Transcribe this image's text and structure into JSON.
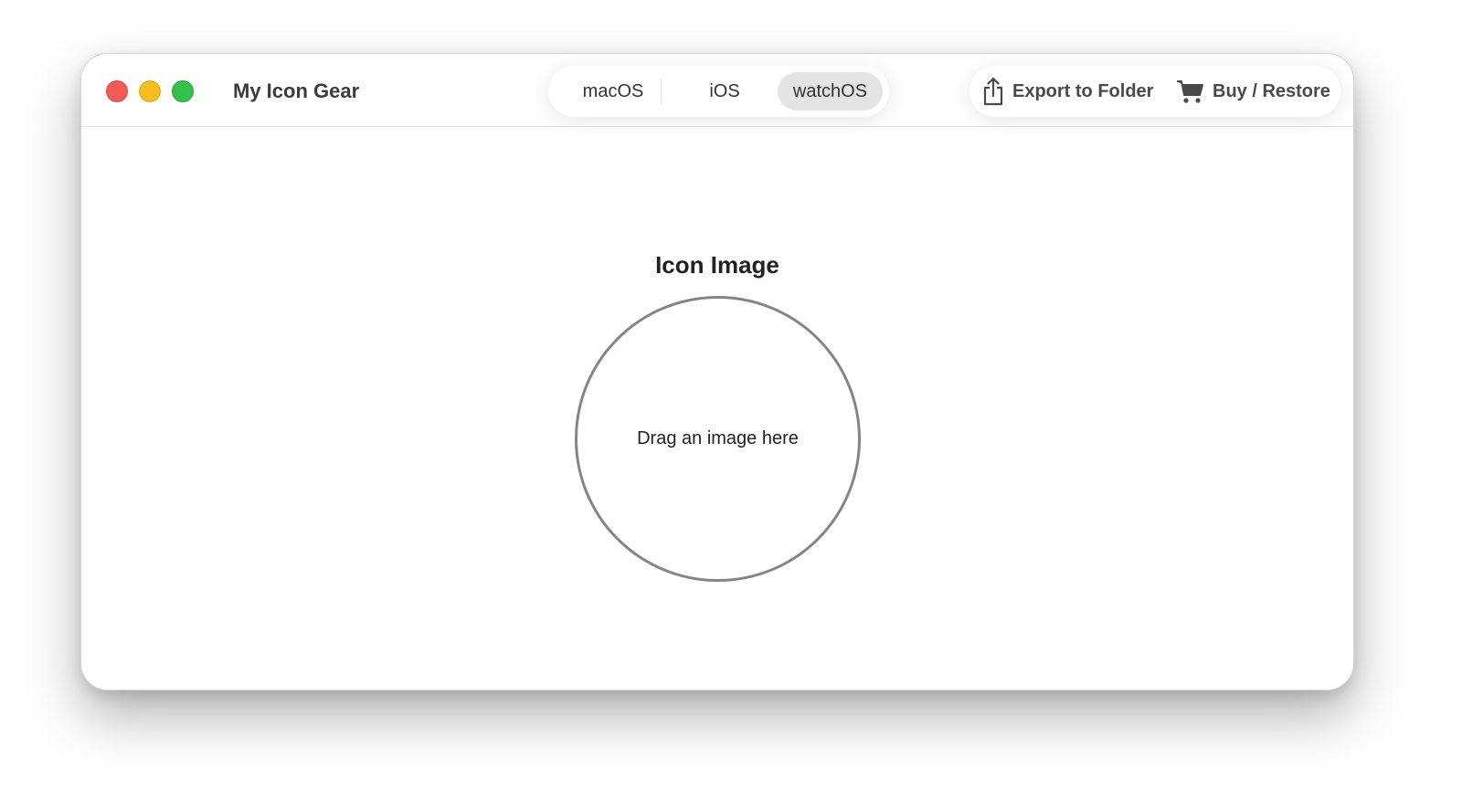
{
  "window": {
    "title": "My Icon Gear"
  },
  "titlebar": {
    "traffic_lights": [
      "close",
      "minimize",
      "maximize"
    ],
    "platform_tabs": [
      {
        "label": "macOS",
        "selected": false
      },
      {
        "label": "iOS",
        "selected": false
      },
      {
        "label": "watchOS",
        "selected": true
      }
    ],
    "actions": {
      "export_label": "Export to Folder",
      "export_icon": "share-export-icon",
      "buy_label": "Buy / Restore",
      "buy_icon": "cart-icon"
    }
  },
  "main": {
    "section_title": "Icon Image",
    "dropzone_label": "Drag an image here"
  },
  "colors": {
    "close": "#f25b58",
    "minimize": "#f6bd1f",
    "maximize": "#35c04a",
    "selected_tab_bg": "#e4e4e4",
    "dropzone_border": "#858585"
  }
}
